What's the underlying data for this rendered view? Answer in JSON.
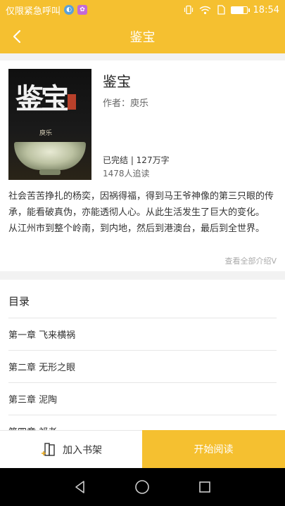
{
  "status_bar": {
    "carrier_text": "仅限紧急呼叫",
    "time": "18:54",
    "battery_level": 0.8,
    "icons": [
      "assistant-icon",
      "app-notification-icon",
      "vibrate-icon",
      "wifi-icon",
      "sim-icon",
      "battery-icon"
    ]
  },
  "header": {
    "title": "鉴宝",
    "back_icon": "chevron-left-icon"
  },
  "book": {
    "title": "鉴宝",
    "author": "作者：庾乐",
    "status": "已完结 | 127万字",
    "readers": "1478人追读",
    "cover": {
      "title_text": "鉴宝",
      "author_text": "庾乐"
    },
    "description": [
      "社会苦苦挣扎的杨奕，因祸得福，得到马王爷神像的第三只眼的传承，能看破真伪，亦能透彻人心。从此生活发生了巨大的变化。",
      "从江州市到整个岭南，到内地，然后到港澳台，最后到全世界。"
    ],
    "view_all": "查看全部介绍V"
  },
  "toc": {
    "heading": "目录",
    "chapters": [
      "第一章 飞来横祸",
      "第二章 无形之眼",
      "第三章 泥陶",
      "第四章 祁老"
    ]
  },
  "actions": {
    "add_to_shelf": "加入书架",
    "start_reading": "开始阅读"
  },
  "nav": {
    "icons": [
      "back-triangle-icon",
      "home-circle-icon",
      "recents-square-icon"
    ]
  },
  "colors": {
    "accent": "#f5c030",
    "background": "#f2f2f2"
  }
}
